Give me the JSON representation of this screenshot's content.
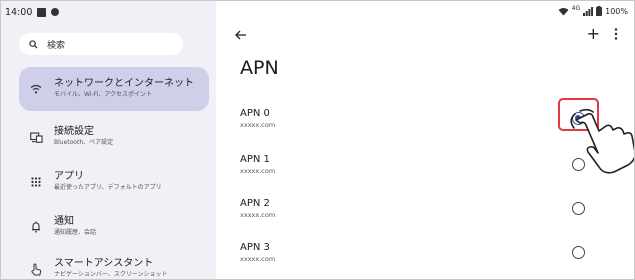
{
  "status": {
    "time": "14:00",
    "network": "4G",
    "battery": "100%"
  },
  "search": {
    "placeholder": "検索"
  },
  "nav": [
    {
      "icon": "wifi-icon",
      "title": "ネットワークとインターネット",
      "subtitle": "モバイル、Wi-Fi、アクセスポイント",
      "active": true
    },
    {
      "icon": "connected-devices-icon",
      "title": "接続設定",
      "subtitle": "Bluetooth、ペア設定",
      "active": false
    },
    {
      "icon": "apps-grid-icon",
      "title": "アプリ",
      "subtitle": "最近使ったアプリ、デフォルトのアプリ",
      "active": false
    },
    {
      "icon": "bell-icon",
      "title": "通知",
      "subtitle": "通知履歴、会話",
      "active": false
    },
    {
      "icon": "touch-hand-icon",
      "title": "スマートアシスタント",
      "subtitle": "ナビゲーションバー、スクリーンショット",
      "active": false
    }
  ],
  "page": {
    "title": "APN",
    "add_label": "+",
    "apns": [
      {
        "name": "APN 0",
        "sub": "xxxxx.com",
        "selected": true
      },
      {
        "name": "APN 1",
        "sub": "xxxxx.com",
        "selected": false
      },
      {
        "name": "APN 2",
        "sub": "xxxxx.com",
        "selected": false
      },
      {
        "name": "APN 3",
        "sub": "xxxxx.com",
        "selected": false
      }
    ]
  },
  "colors": {
    "left_bg": "#f1f0f6",
    "active_bg": "#cfcfe9",
    "radio_selected": "#2f4f8f",
    "highlight": "#e0393e"
  }
}
